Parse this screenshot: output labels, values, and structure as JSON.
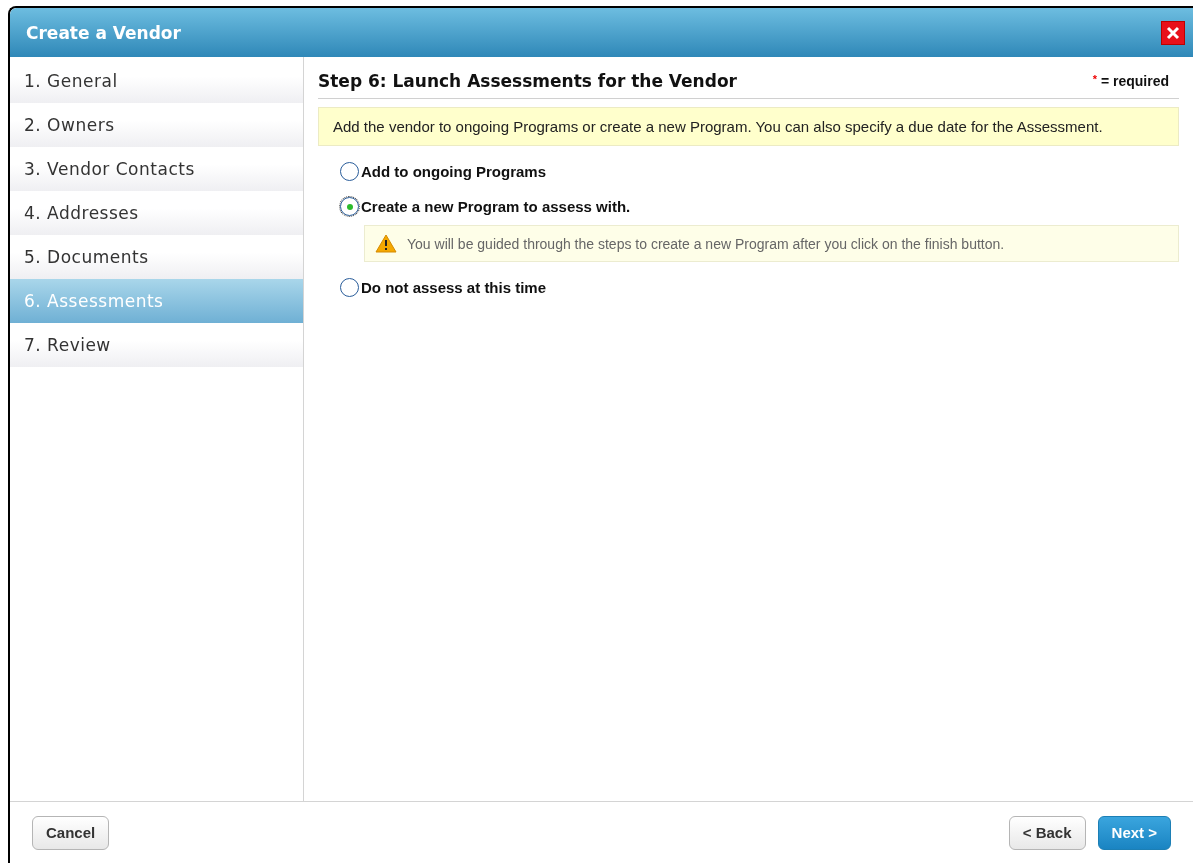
{
  "window": {
    "title": "Create a Vendor"
  },
  "sidebar": {
    "items": [
      {
        "label": "1. General",
        "selected": false
      },
      {
        "label": "2. Owners",
        "selected": false
      },
      {
        "label": "3. Vendor Contacts",
        "selected": false
      },
      {
        "label": "4. Addresses",
        "selected": false
      },
      {
        "label": "5. Documents",
        "selected": false
      },
      {
        "label": "6. Assessments",
        "selected": true
      },
      {
        "label": "7. Review",
        "selected": false
      }
    ]
  },
  "content": {
    "heading": "Step 6: Launch Assessments for the Vendor",
    "required_mark": "*",
    "required_text": "= required",
    "info": "Add the vendor to ongoing Programs or create a new Program. You can also specify a due date for the Assessment.",
    "options": [
      {
        "label": "Add to ongoing Programs",
        "selected": false
      },
      {
        "label": "Create a new Program to assess with.",
        "selected": true,
        "note": "You will be guided through the steps to create a new Program after you click on the finish button."
      },
      {
        "label": "Do not assess at this time",
        "selected": false
      }
    ]
  },
  "footer": {
    "cancel": "Cancel",
    "back": "< Back",
    "next": "Next >"
  }
}
